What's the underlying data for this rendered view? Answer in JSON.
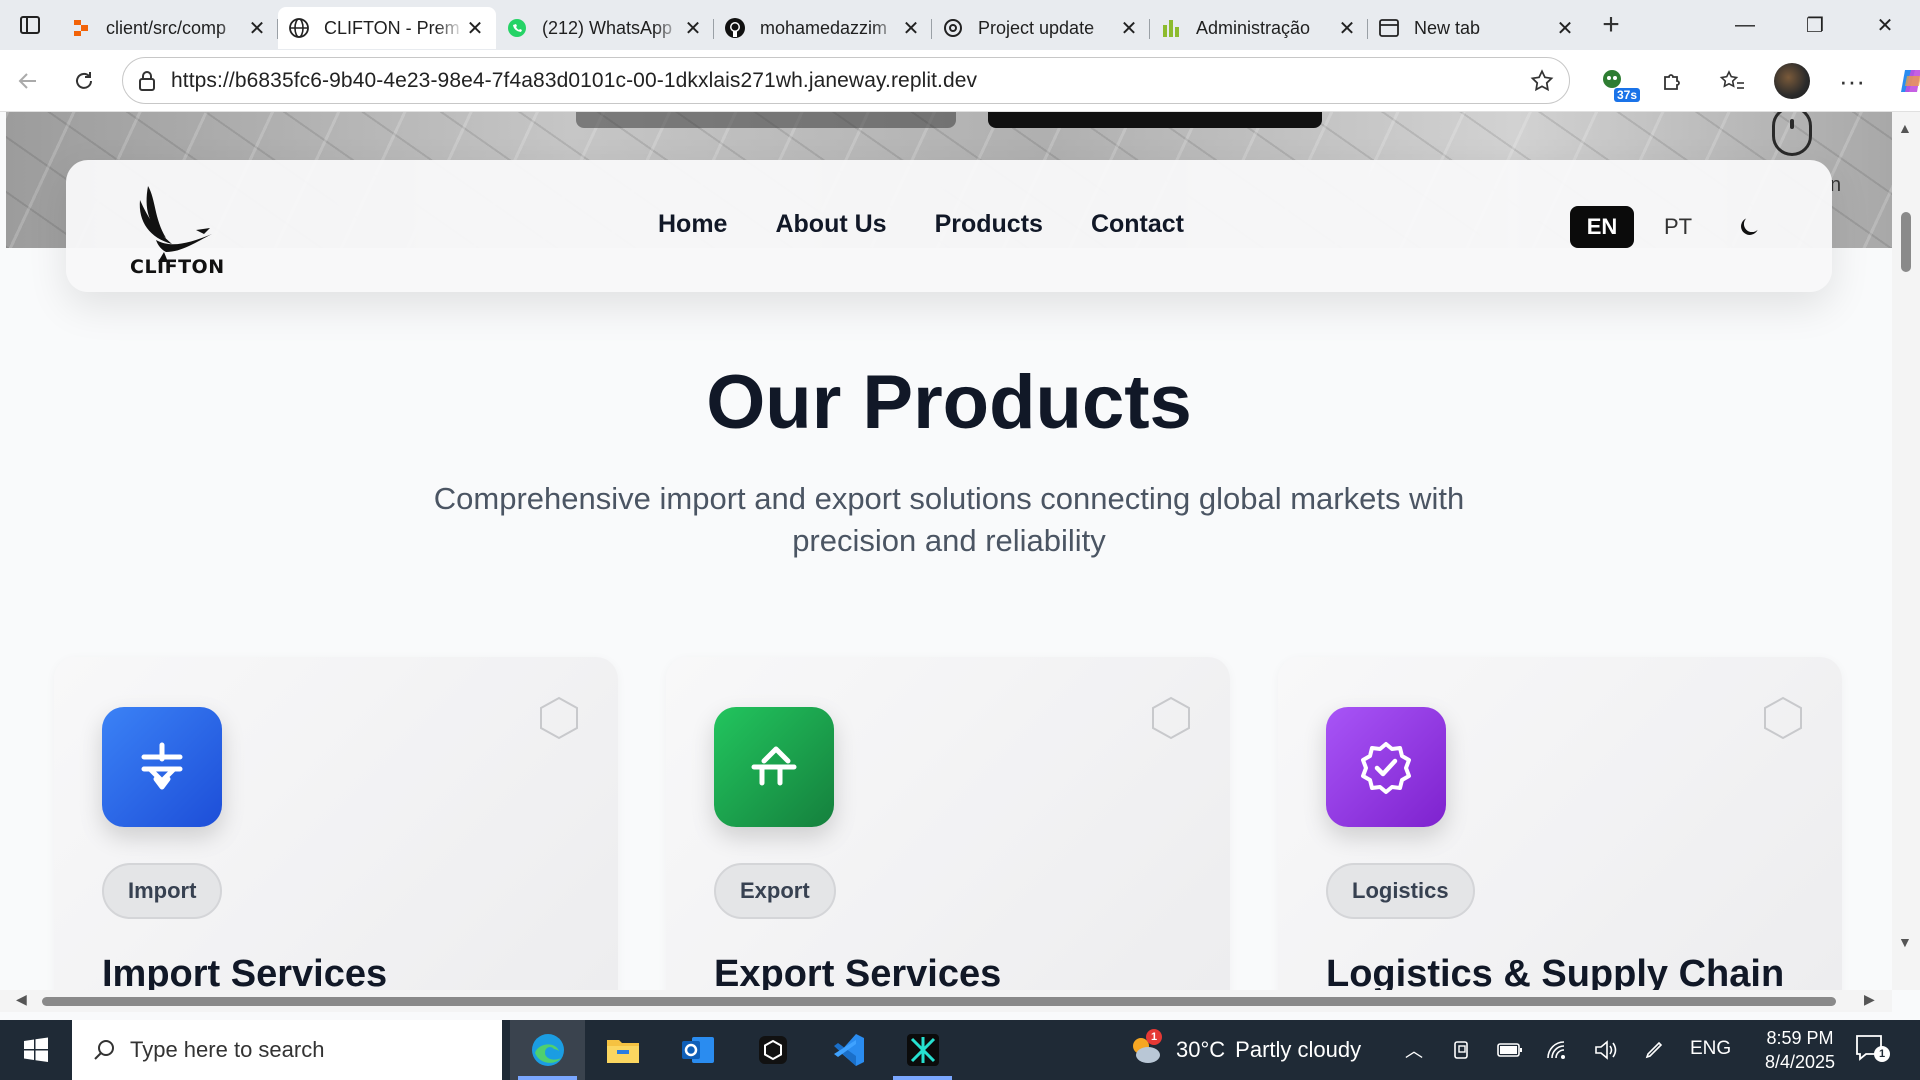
{
  "browser": {
    "tabs": [
      {
        "label": "client/src/comp",
        "icon": "replit-icon",
        "active": false
      },
      {
        "label": "CLIFTON - Prem",
        "icon": "globe-icon",
        "active": true
      },
      {
        "label": "(212) WhatsApp",
        "icon": "whatsapp-icon",
        "active": false
      },
      {
        "label": "mohamedazzim",
        "icon": "github-icon",
        "active": false
      },
      {
        "label": "Project update",
        "icon": "openai-icon",
        "active": false
      },
      {
        "label": "Administração",
        "icon": "admin-icon",
        "active": false
      },
      {
        "label": "New tab",
        "icon": "newtab-icon",
        "active": false
      }
    ],
    "url": "https://b6835fc6-9b40-4e23-98e4-7f4a83d0101c-00-1dkxlais271wh.janeway.replit.dev",
    "extension_badge": "37s"
  },
  "site": {
    "logo_text": "CLIFTON",
    "nav": [
      "Home",
      "About Us",
      "Products",
      "Contact"
    ],
    "lang_active": "EN",
    "lang_other": "PT",
    "hero_fragment": "n"
  },
  "section": {
    "title": "Our Products",
    "subtitle": "Comprehensive import and export solutions connecting global markets with precision and reliability"
  },
  "cards": [
    {
      "tag": "Import",
      "title": "Import Services",
      "color": "#2563eb",
      "icon": "import-icon"
    },
    {
      "tag": "Export",
      "title": "Export Services",
      "color": "#16a34a",
      "icon": "export-icon"
    },
    {
      "tag": "Logistics",
      "title": "Logistics & Supply Chain",
      "color": "#9333ea",
      "icon": "badge-check-icon"
    }
  ],
  "taskbar": {
    "search_placeholder": "Type here to search",
    "weather_temp": "30°C",
    "weather_text": "Partly cloudy",
    "weather_badge": "1",
    "lang": "ENG",
    "time": "8:59 PM",
    "date": "8/4/2025",
    "notifications": "1"
  }
}
